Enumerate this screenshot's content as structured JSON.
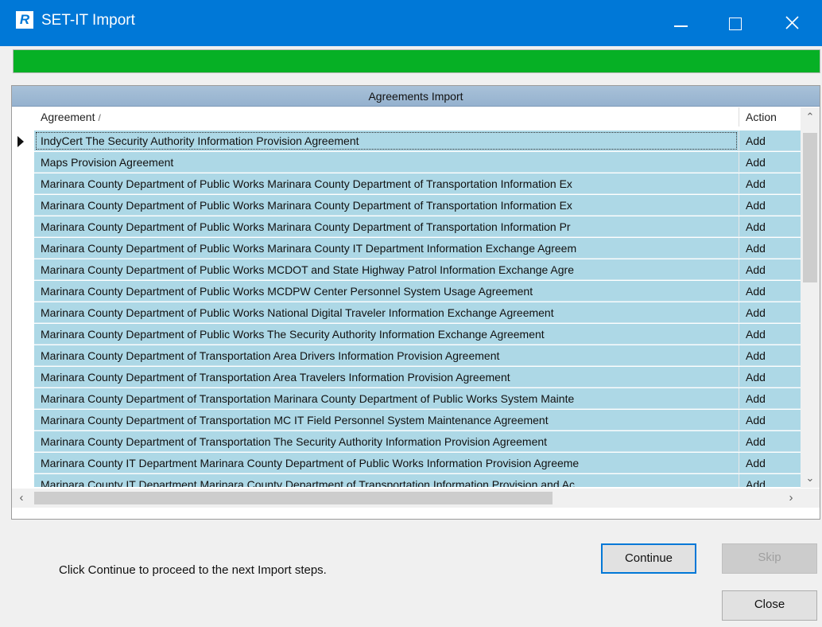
{
  "window": {
    "title": "SET-IT Import",
    "app_icon_letter": "R",
    "controls": {
      "minimize": "minimize-icon",
      "maximize": "maximize-icon",
      "close": "close-icon"
    }
  },
  "progress": {
    "value": 1.0,
    "color": "#06b025"
  },
  "grid": {
    "caption": "Agreements Import",
    "columns": {
      "agreement": "Agreement",
      "agreement_sort": "/",
      "action": "Action"
    },
    "rows": [
      {
        "agreement": "IndyCert The Security Authority Information Provision Agreement",
        "action": "Add",
        "current": true
      },
      {
        "agreement": "Maps Provision Agreement",
        "action": "Add"
      },
      {
        "agreement": "Marinara County Department of Public Works Marinara County Department of Transportation Information Ex",
        "action": "Add"
      },
      {
        "agreement": "Marinara County Department of Public Works Marinara County Department of Transportation Information Ex",
        "action": "Add"
      },
      {
        "agreement": "Marinara County Department of Public Works Marinara County Department of Transportation Information Pr",
        "action": "Add"
      },
      {
        "agreement": "Marinara County Department of Public Works Marinara County IT Department Information Exchange Agreem",
        "action": "Add"
      },
      {
        "agreement": "Marinara County Department of Public Works MCDOT and State Highway Patrol Information Exchange Agre",
        "action": "Add"
      },
      {
        "agreement": "Marinara County Department of Public Works MCDPW Center Personnel System Usage Agreement",
        "action": "Add"
      },
      {
        "agreement": "Marinara County Department of Public Works National Digital Traveler Information Exchange Agreement",
        "action": "Add"
      },
      {
        "agreement": "Marinara County Department of Public Works The Security Authority Information Exchange Agreement",
        "action": "Add"
      },
      {
        "agreement": "Marinara County Department of Transportation Area Drivers Information Provision Agreement",
        "action": "Add"
      },
      {
        "agreement": "Marinara County Department of Transportation Area Travelers Information Provision Agreement",
        "action": "Add"
      },
      {
        "agreement": "Marinara County Department of Transportation Marinara County Department of Public Works System Mainte",
        "action": "Add"
      },
      {
        "agreement": "Marinara County Department of Transportation MC IT Field Personnel System Maintenance Agreement",
        "action": "Add"
      },
      {
        "agreement": "Marinara County Department of Transportation The Security Authority Information Provision Agreement",
        "action": "Add"
      },
      {
        "agreement": "Marinara County IT Department Marinara County Department of Public Works Information Provision Agreeme",
        "action": "Add"
      },
      {
        "agreement": "Marinara County IT Department Marinara County Department of Transportation Information Provision and Ac",
        "action": "Add"
      }
    ],
    "row_color": "#add8e6"
  },
  "scrollbars": {
    "up": "chevron-up-icon",
    "down": "chevron-down-icon",
    "left": "chevron-left-icon",
    "right": "chevron-right-icon"
  },
  "status_text": "Click Continue to proceed to the next Import steps.",
  "buttons": {
    "continue": "Continue",
    "skip": "Skip",
    "close": "Close"
  }
}
